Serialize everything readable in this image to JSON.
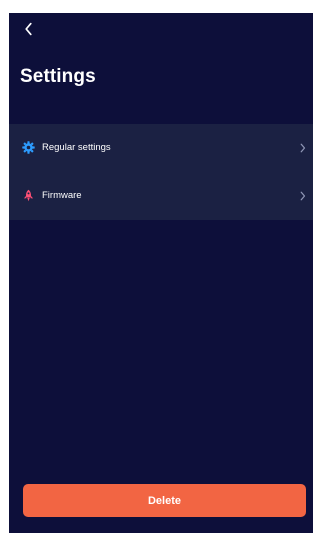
{
  "header": {
    "back_icon": "chevron-left-icon",
    "title": "Settings"
  },
  "settings": {
    "items": [
      {
        "label": "Regular settings",
        "icon": "gear-icon",
        "chevron": "chevron-right-icon"
      },
      {
        "label": "Firmware",
        "icon": "rocket-icon",
        "chevron": "chevron-right-icon"
      }
    ]
  },
  "footer": {
    "delete_label": "Delete"
  },
  "colors": {
    "background": "#0d0f3a",
    "list_background": "#1b2143",
    "text_primary": "#ffffff",
    "gear_icon": "#2d9cff",
    "rocket_icon": "#ff4f75",
    "delete_button": "#f26543"
  }
}
